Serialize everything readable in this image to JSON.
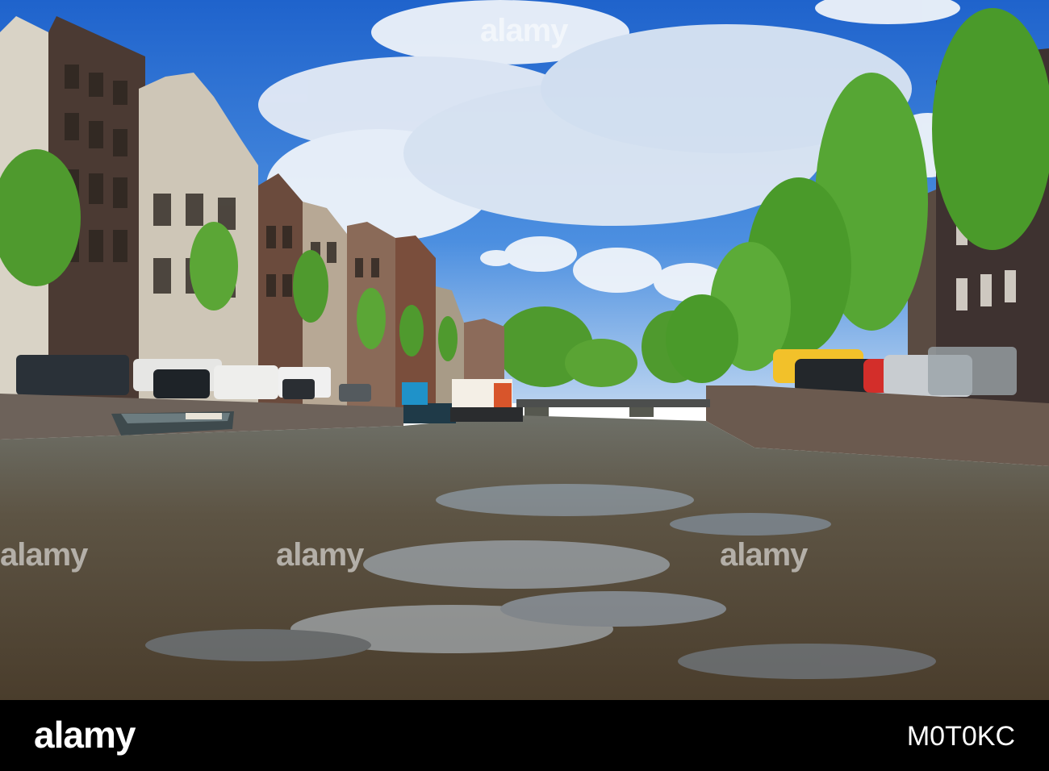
{
  "image": {
    "subject": "canal-with-gabled-canal-houses-trees-bridge-and-boats",
    "watermark_text": "alamy",
    "footer": {
      "logo_text": "alamy",
      "image_id": "M0T0KC"
    },
    "colors": {
      "sky": "#2f76d6",
      "water": "#5b5142",
      "foliage": "#4e9a2e",
      "footer_bg": "#000000"
    }
  }
}
